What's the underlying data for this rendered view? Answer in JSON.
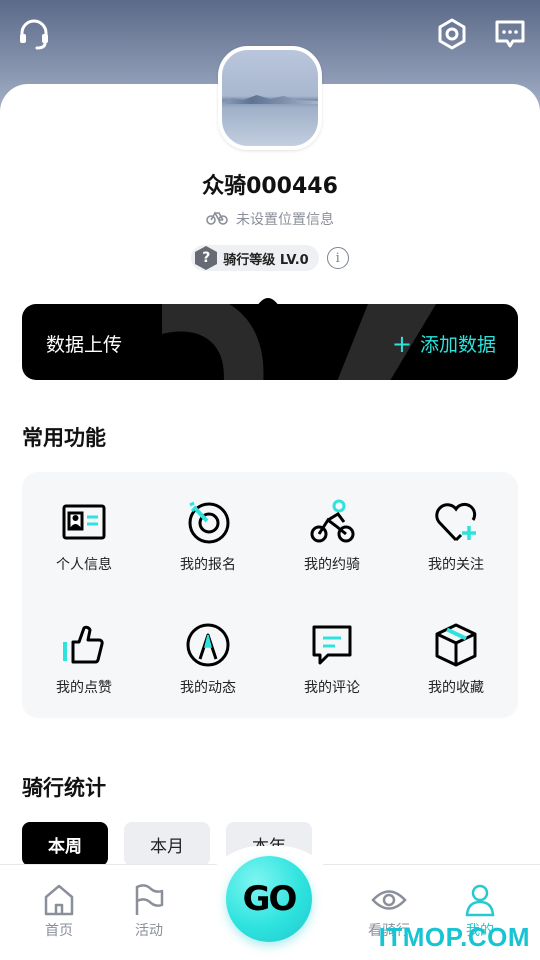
{
  "header": {
    "support_icon": "headset-icon",
    "settings_icon": "settings-icon",
    "message_icon": "message-icon"
  },
  "profile": {
    "username": "众骑000446",
    "location": "未设置位置信息",
    "level_label": "骑行等级 LV.0",
    "level_badge_char": "?",
    "info_char": "i"
  },
  "upload": {
    "title": "数据上传",
    "add_label": "添加数据",
    "add_symbol": "+"
  },
  "common": {
    "title": "常用功能",
    "items": [
      {
        "label": "个人信息",
        "icon": "id-card-icon"
      },
      {
        "label": "我的报名",
        "icon": "target-icon"
      },
      {
        "label": "我的约骑",
        "icon": "cyclist-icon"
      },
      {
        "label": "我的关注",
        "icon": "heart-plus-icon"
      },
      {
        "label": "我的点赞",
        "icon": "thumbs-up-icon"
      },
      {
        "label": "我的动态",
        "icon": "compass-icon"
      },
      {
        "label": "我的评论",
        "icon": "comment-icon"
      },
      {
        "label": "我的收藏",
        "icon": "box-icon"
      }
    ]
  },
  "stats": {
    "title": "骑行统计",
    "tabs": [
      {
        "label": "本周",
        "active": true
      },
      {
        "label": "本月",
        "active": false
      },
      {
        "label": "本年",
        "active": false
      }
    ]
  },
  "nav": {
    "home": "首页",
    "activity": "活动",
    "go": "GO",
    "watch": "看骑行",
    "mine": "我的"
  },
  "watermark": "ITMOP.COM",
  "colors": {
    "accent": "#2ee3de",
    "active_nav": "#27c9d1",
    "header_top": "#5b6a88"
  }
}
